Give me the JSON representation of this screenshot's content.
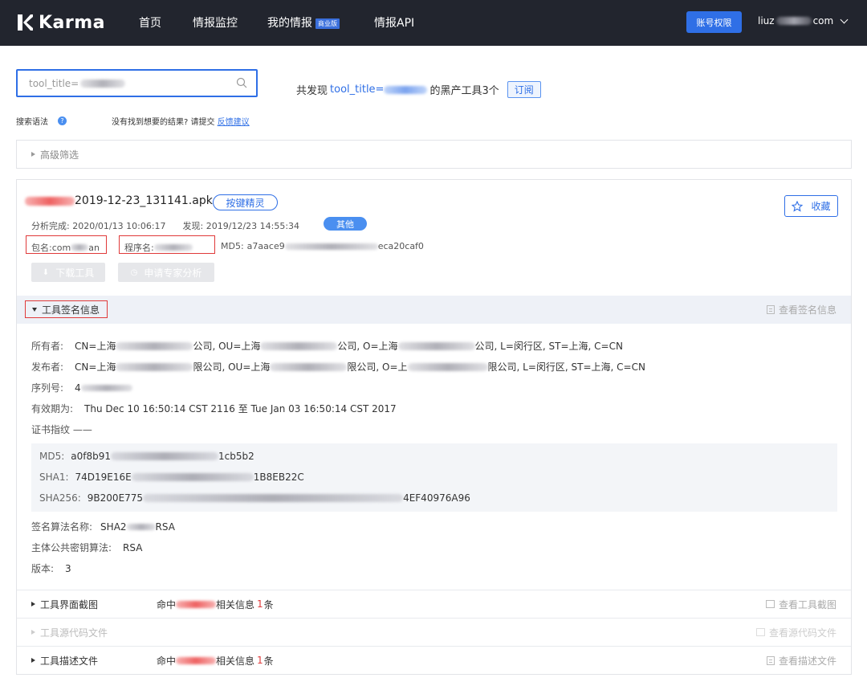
{
  "nav": {
    "brand": "Karma",
    "items": [
      "首页",
      "情报监控",
      "我的情报",
      "情报API"
    ],
    "badge": "商业版",
    "perm_button": "账号权限",
    "user_prefix": "liuz",
    "user_suffix": "com"
  },
  "search": {
    "value": "tool_title=",
    "result_prefix": "共发现",
    "result_key": "tool_title=",
    "result_suffix": "的黑产工具3个",
    "subscribe": "订阅",
    "syntax_label": "搜索语法",
    "help": "?",
    "feedback_text": "没有找到想要的结果? 请提交",
    "feedback_link": "反馈建议"
  },
  "advanced_filter": "高级筛选",
  "tool": {
    "title_suffix": "2019-12-23_131141.apk",
    "category_tag": "按键精灵",
    "favorite": "收藏",
    "analysis_done_label": "分析完成:",
    "analysis_done": "2020/01/13 10:06:17",
    "found_label": "发现:",
    "found": "2019/12/23 14:55:34",
    "type_tag": "其他",
    "package_label": "包名:",
    "package_prefix": "com",
    "package_suffix": "an",
    "program_label": "程序名:",
    "md5_label": "MD5:",
    "md5_prefix": "a7aace9",
    "md5_suffix": "eca20caf0",
    "download": "下载工具",
    "expert": "申请专家分析"
  },
  "signature": {
    "title": "工具签名信息",
    "view_link": "查看签名信息",
    "owner_label": "所有者:",
    "owner_parts": [
      "CN=上海",
      "公司, OU=上海",
      "公司, O=上海",
      "公司, L=闵行区, ST=上海, C=CN"
    ],
    "issuer_label": "发布者:",
    "issuer_parts": [
      "CN=上海",
      "限公司, OU=上海",
      "限公司, O=上",
      "限公司, L=闵行区, ST=上海, C=CN"
    ],
    "serial_label": "序列号:",
    "serial_prefix": "4",
    "validity_label": "有效期为:",
    "validity": "Thu Dec 10 16:50:14 CST 2116 至 Tue Jan 03 16:50:14 CST 2017",
    "fingerprint_label": "证书指纹 ——",
    "fp_md5_label": "MD5:",
    "fp_md5_prefix": "a0f8b91",
    "fp_md5_suffix": "1cb5b2",
    "fp_sha1_label": "SHA1:",
    "fp_sha1_prefix": "74D19E16E",
    "fp_sha1_suffix": "1B8EB22C",
    "fp_sha256_label": "SHA256:",
    "fp_sha256_prefix": "9B200E775",
    "fp_sha256_suffix": "4EF40976A96",
    "algo_label": "签名算法名称:",
    "algo_prefix": "SHA2",
    "algo_suffix": "RSA",
    "pubkey_label": "主体公共密钥算法:",
    "pubkey": "RSA",
    "version_label": "版本:",
    "version": "3"
  },
  "sections": [
    {
      "title": "工具界面截图",
      "hit_prefix": "命中",
      "hit_mid": "相关信息",
      "hit_count": "1",
      "hit_unit": "条",
      "link": "查看工具截图"
    },
    {
      "title": "工具源代码文件",
      "link": "查看源代码文件"
    },
    {
      "title": "工具描述文件",
      "hit_prefix": "命中",
      "hit_mid": "相关信息",
      "hit_count": "1",
      "hit_unit": "条",
      "link": "查看描述文件"
    }
  ]
}
